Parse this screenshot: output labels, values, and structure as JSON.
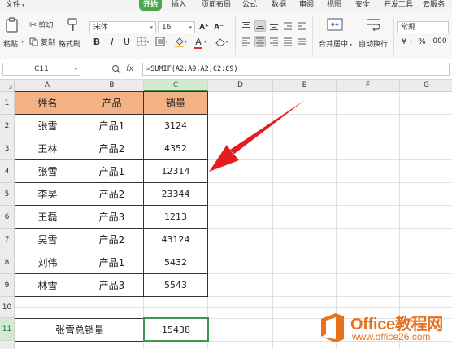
{
  "menu": {
    "items": [
      {
        "label": "文件",
        "caret": "▾"
      },
      {
        "label": "开始",
        "active": true
      },
      {
        "label": "插入"
      },
      {
        "label": "页面布局"
      },
      {
        "label": "公式"
      },
      {
        "label": "数据"
      },
      {
        "label": "审阅"
      },
      {
        "label": "视图"
      },
      {
        "label": "安全"
      },
      {
        "label": "开发工具"
      },
      {
        "label": "云服务"
      }
    ]
  },
  "ribbon": {
    "paste_label": "粘贴",
    "cut_label": "剪切",
    "copy_label": "复制",
    "format_painter_label": "格式刷",
    "font_name": "宋体",
    "font_size": "16",
    "grow_font": "A⁺",
    "shrink_font": "A⁻",
    "bold": "B",
    "italic": "I",
    "underline": "U",
    "merge_center_label": "合并居中",
    "wrap_text_label": "自动换行",
    "number_format": "常规",
    "currency_symbol": "¥",
    "percent_symbol": "%",
    "thousands_symbol": "000",
    "accent_color": "#4aa54f",
    "font_color": "#e03030",
    "fill_color": "#f5c242"
  },
  "formula_bar": {
    "cell_ref": "C11",
    "zoom_icon": "magnifier-icon",
    "fx": "fx",
    "formula": "=SUMIF(A2:A9,A2,C2:C9)"
  },
  "sheet": {
    "columns": [
      "A",
      "B",
      "C",
      "D",
      "E",
      "F",
      "G"
    ],
    "rows": [
      "1",
      "2",
      "3",
      "4",
      "5",
      "6",
      "7",
      "8",
      "9",
      "10",
      "11"
    ],
    "header_fill": "#f4b183",
    "table": {
      "headers": [
        "姓名",
        "产品",
        "销量"
      ],
      "rows": [
        [
          "张雪",
          "产品1",
          "3124"
        ],
        [
          "王林",
          "产品2",
          "4352"
        ],
        [
          "张雪",
          "产品1",
          "12314"
        ],
        [
          "李昊",
          "产品2",
          "23344"
        ],
        [
          "王磊",
          "产品3",
          "1213"
        ],
        [
          "吴雪",
          "产品2",
          "43124"
        ],
        [
          "刘伟",
          "产品1",
          "5432"
        ],
        [
          "林雪",
          "产品3",
          "5543"
        ]
      ]
    },
    "summary_label": "张雪总销量",
    "summary_value": "15438"
  },
  "watermark": {
    "title": "Office教程网",
    "url": "www.office26.com"
  }
}
